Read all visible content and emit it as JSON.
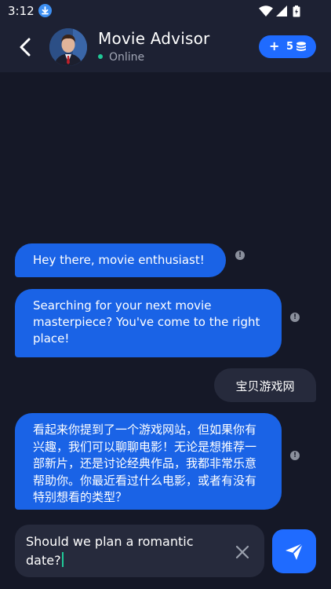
{
  "status_bar": {
    "time": "3:12",
    "icons": [
      "download-icon",
      "wifi-icon",
      "signal-icon",
      "battery-icon"
    ]
  },
  "header": {
    "title": "Movie Advisor",
    "status": "Online",
    "credits": "5"
  },
  "messages": [
    {
      "sender": "bot",
      "text": "Hey there, movie enthusiast!"
    },
    {
      "sender": "bot",
      "text": "Searching for your next movie masterpiece? You've come to the right place!"
    },
    {
      "sender": "user",
      "text": "宝贝游戏网"
    },
    {
      "sender": "bot",
      "text": "看起来你提到了一个游戏网站，但如果你有兴趣，我们可以聊聊电影！无论是想推荐一部新片，还是讨论经典作品，我都非常乐意帮助你。你最近看过什么电影，或者有没有特别想看的类型？"
    }
  ],
  "composer": {
    "value": "Should we plan a romantic date?"
  },
  "colors": {
    "background": "#151827",
    "header": "#1d2133",
    "bot_bubble": "#1a63e6",
    "user_bubble": "#262a3c",
    "accent": "#1f6bff",
    "online": "#20c997"
  }
}
